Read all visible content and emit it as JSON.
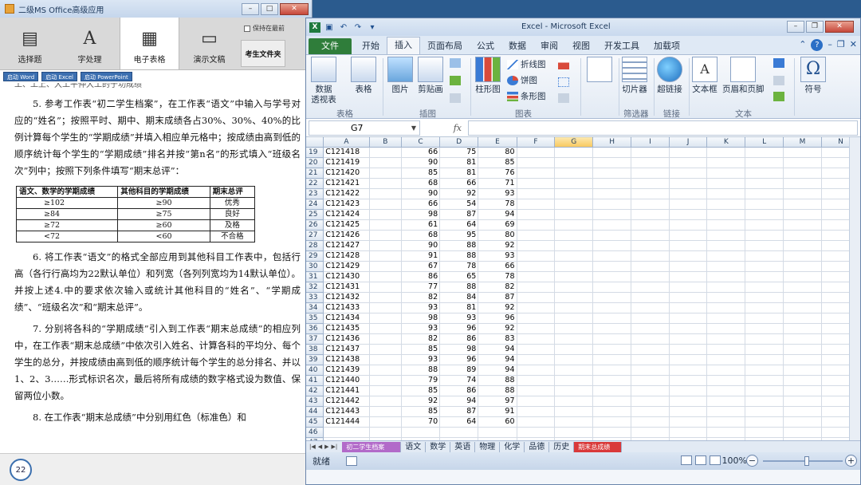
{
  "exam": {
    "title": "二级MS Office高级应用",
    "nav": [
      {
        "label": "选择题",
        "icon": "document-icon"
      },
      {
        "label": "字处理",
        "icon": "letter-a-icon"
      },
      {
        "label": "电子表格",
        "icon": "spreadsheet-icon"
      },
      {
        "label": "演示文稿",
        "icon": "slideshow-icon"
      }
    ],
    "keep_on_top": "保持在最前",
    "folder_button": "考生文件夹",
    "launchers": [
      "启动 Word",
      "启动 Excel",
      "启动 PowerPoint"
    ],
    "partial_top_line": "工、工上、大工平仲大工的于功成绩",
    "para5": "5. 参考工作表“初二学生档案”，在工作表“语文”中输入与学号对应的“姓名”；按照平时、期中、期末成绩各占30%、30%、40%的比例计算每个学生的“学期成绩”并填入相应单元格中；按成绩由高到低的顺序统计每个学生的“学期成绩”排名并按“第n名”的形式填入“班级名次”列中；按照下列条件填写“期末总评”：",
    "criteria_table": {
      "headers": [
        "语文、数学的学期成绩",
        "其他科目的学期成绩",
        "期末总评"
      ],
      "rows": [
        [
          "≥102",
          "≥90",
          "优秀"
        ],
        [
          "≥84",
          "≥75",
          "良好"
        ],
        [
          "≥72",
          "≥60",
          "及格"
        ],
        [
          "<72",
          "<60",
          "不合格"
        ]
      ]
    },
    "para6": "6. 将工作表“语文”的格式全部应用到其他科目工作表中，包括行高（各行行高均为22默认单位）和列宽（各列列宽均为14默认单位）。并按上述4.中的要求依次输入或统计其他科目的“姓名”、“学期成绩”、“班级名次”和“期末总评”。",
    "para7": "7. 分别将各科的“学期成绩”引入到工作表“期末总成绩”的相应列中，在工作表“期末总成绩”中依次引入姓名、计算各科的平均分、每个学生的总分，并按成绩由高到低的顺序统计每个学生的总分排名、并以1、2、3……形式标识名次，最后将所有成绩的数字格式设为数值、保留两位小数。",
    "para8": "8. 在工作表“期末总成绩”中分别用红色（标准色）和",
    "page_number": "22"
  },
  "excel": {
    "title": "Excel - Microsoft Excel",
    "tabs": [
      "文件",
      "开始",
      "插入",
      "页面布局",
      "公式",
      "数据",
      "审阅",
      "视图",
      "开发工具",
      "加载项"
    ],
    "active_tab": "插入",
    "ribbon": {
      "pivot": "数据\n透视表",
      "table": "表格",
      "picture": "图片",
      "clipart": "剪贴画",
      "column_chart": "柱形图",
      "line_chart": "折线图",
      "pie_chart": "饼图",
      "bar_chart": "条形图",
      "slicer": "切片器",
      "hyperlink": "超链接",
      "textbox": "文本框",
      "header_footer": "页眉和页脚",
      "symbol": "符号",
      "groups": [
        "表格",
        "插图",
        "图表",
        "筛选器",
        "链接",
        "文本"
      ]
    },
    "name_box": "G7",
    "fx": "fx",
    "columns": [
      "A",
      "B",
      "C",
      "D",
      "E",
      "F",
      "G",
      "H",
      "I",
      "J",
      "K",
      "L",
      "M",
      "N"
    ],
    "selected_column": "G",
    "rows": [
      {
        "r": "19",
        "a": "C121418",
        "c": "66",
        "d": "75",
        "e": "80"
      },
      {
        "r": "20",
        "a": "C121419",
        "c": "90",
        "d": "81",
        "e": "85"
      },
      {
        "r": "21",
        "a": "C121420",
        "c": "85",
        "d": "81",
        "e": "76"
      },
      {
        "r": "22",
        "a": "C121421",
        "c": "68",
        "d": "66",
        "e": "71"
      },
      {
        "r": "23",
        "a": "C121422",
        "c": "90",
        "d": "92",
        "e": "93"
      },
      {
        "r": "24",
        "a": "C121423",
        "c": "66",
        "d": "54",
        "e": "78"
      },
      {
        "r": "25",
        "a": "C121424",
        "c": "98",
        "d": "87",
        "e": "94"
      },
      {
        "r": "26",
        "a": "C121425",
        "c": "61",
        "d": "64",
        "e": "69"
      },
      {
        "r": "27",
        "a": "C121426",
        "c": "68",
        "d": "95",
        "e": "80"
      },
      {
        "r": "28",
        "a": "C121427",
        "c": "90",
        "d": "88",
        "e": "92"
      },
      {
        "r": "29",
        "a": "C121428",
        "c": "91",
        "d": "88",
        "e": "93"
      },
      {
        "r": "30",
        "a": "C121429",
        "c": "67",
        "d": "78",
        "e": "66"
      },
      {
        "r": "31",
        "a": "C121430",
        "c": "86",
        "d": "65",
        "e": "78"
      },
      {
        "r": "32",
        "a": "C121431",
        "c": "77",
        "d": "88",
        "e": "82"
      },
      {
        "r": "33",
        "a": "C121432",
        "c": "82",
        "d": "84",
        "e": "87"
      },
      {
        "r": "34",
        "a": "C121433",
        "c": "93",
        "d": "81",
        "e": "92"
      },
      {
        "r": "35",
        "a": "C121434",
        "c": "98",
        "d": "93",
        "e": "96"
      },
      {
        "r": "36",
        "a": "C121435",
        "c": "93",
        "d": "96",
        "e": "92"
      },
      {
        "r": "37",
        "a": "C121436",
        "c": "82",
        "d": "86",
        "e": "83"
      },
      {
        "r": "38",
        "a": "C121437",
        "c": "85",
        "d": "98",
        "e": "94"
      },
      {
        "r": "39",
        "a": "C121438",
        "c": "93",
        "d": "96",
        "e": "94"
      },
      {
        "r": "40",
        "a": "C121439",
        "c": "88",
        "d": "89",
        "e": "94"
      },
      {
        "r": "41",
        "a": "C121440",
        "c": "79",
        "d": "74",
        "e": "88"
      },
      {
        "r": "42",
        "a": "C121441",
        "c": "85",
        "d": "86",
        "e": "88"
      },
      {
        "r": "43",
        "a": "C121442",
        "c": "92",
        "d": "94",
        "e": "97"
      },
      {
        "r": "44",
        "a": "C121443",
        "c": "85",
        "d": "87",
        "e": "91"
      },
      {
        "r": "45",
        "a": "C121444",
        "c": "70",
        "d": "64",
        "e": "60"
      },
      {
        "r": "46",
        "a": "",
        "c": "",
        "d": "",
        "e": ""
      },
      {
        "r": "47",
        "a": "",
        "c": "",
        "d": "",
        "e": ""
      }
    ],
    "sheets": [
      {
        "label": "初二学生档案",
        "style": "purple"
      },
      {
        "label": "语文",
        "style": ""
      },
      {
        "label": "数学",
        "style": ""
      },
      {
        "label": "英语",
        "style": ""
      },
      {
        "label": "物理",
        "style": ""
      },
      {
        "label": "化学",
        "style": ""
      },
      {
        "label": "品德",
        "style": ""
      },
      {
        "label": "历史",
        "style": ""
      },
      {
        "label": "期末总成绩",
        "style": "red"
      }
    ],
    "status": "就绪",
    "zoom": "100%"
  },
  "colors": {
    "file_tab": "#2f7d3a",
    "selected_header": "#f8c960",
    "sheet_purple": "#b26ac9",
    "sheet_red": "#d9393a"
  }
}
